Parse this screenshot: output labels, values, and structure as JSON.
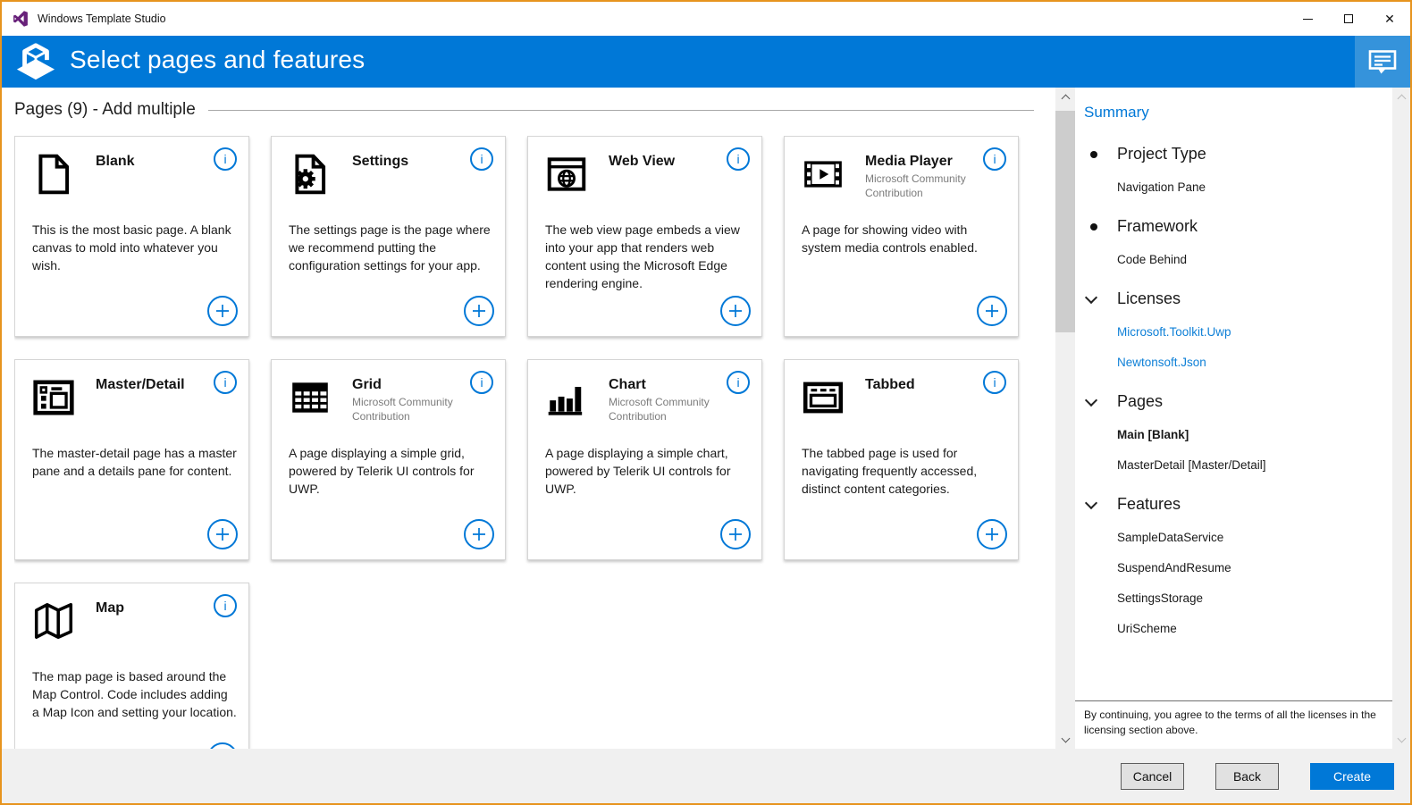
{
  "window": {
    "title": "Windows Template Studio",
    "app_icon": "visual-studio-icon",
    "controls": [
      {
        "icon": "minimize-icon"
      },
      {
        "icon": "maximize-icon"
      },
      {
        "icon": "close-icon"
      }
    ]
  },
  "header": {
    "title": "Select pages and features",
    "logo_icon": "wts-logo-icon",
    "feedback_icon": "feedback-icon"
  },
  "content": {
    "section_title": "Pages (9) - Add multiple",
    "card_info_icon": "info-icon",
    "card_add_icon": "add-icon",
    "cards": [
      {
        "title": "Blank",
        "subtitle": "",
        "icon": "blank-page-icon",
        "description": "This is the most basic page. A blank canvas to mold into whatever you wish."
      },
      {
        "title": "Settings",
        "subtitle": "",
        "icon": "settings-page-icon",
        "description": "The settings page is the page where we recommend putting the configuration settings for your app."
      },
      {
        "title": "Web View",
        "subtitle": "",
        "icon": "web-view-icon",
        "description": "The web view page embeds a view into your app that renders web content using the Microsoft Edge rendering engine."
      },
      {
        "title": "Media Player",
        "subtitle": "Microsoft Community Contribution",
        "icon": "media-player-icon",
        "description": "A page for showing video with system media controls enabled."
      },
      {
        "title": "Master/Detail",
        "subtitle": "",
        "icon": "master-detail-icon",
        "description": "The master-detail page has a master pane and a details pane for content."
      },
      {
        "title": "Grid",
        "subtitle": "Microsoft Community Contribution",
        "icon": "grid-icon",
        "description": "A page displaying a simple grid, powered by Telerik UI controls for UWP."
      },
      {
        "title": "Chart",
        "subtitle": "Microsoft Community Contribution",
        "icon": "chart-icon",
        "description": "A page displaying a simple chart, powered by Telerik UI controls for UWP."
      },
      {
        "title": "Tabbed",
        "subtitle": "",
        "icon": "tabbed-icon",
        "description": "The tabbed page is used for navigating frequently accessed, distinct content categories."
      },
      {
        "title": "Map",
        "subtitle": "",
        "icon": "map-icon",
        "description": "The map page is based around the Map Control. Code includes adding a Map Icon and setting your location."
      }
    ]
  },
  "sidebar": {
    "title": "Summary",
    "sections": [
      {
        "label": "Project Type",
        "marker": "bullet-icon",
        "items": [
          {
            "label": "Navigation Pane",
            "style": "plain"
          }
        ]
      },
      {
        "label": "Framework",
        "marker": "bullet-icon",
        "items": [
          {
            "label": "Code Behind",
            "style": "plain"
          }
        ]
      },
      {
        "label": "Licenses",
        "marker": "chevron-down-icon",
        "items": [
          {
            "label": "Microsoft.Toolkit.Uwp",
            "style": "link"
          },
          {
            "label": "Newtonsoft.Json",
            "style": "link"
          }
        ]
      },
      {
        "label": "Pages",
        "marker": "chevron-down-icon",
        "items": [
          {
            "label": "Main [Blank]",
            "style": "bold"
          },
          {
            "label": "MasterDetail [Master/Detail]",
            "style": "plain"
          }
        ]
      },
      {
        "label": "Features",
        "marker": "chevron-down-icon",
        "items": [
          {
            "label": "SampleDataService",
            "style": "plain"
          },
          {
            "label": "SuspendAndResume",
            "style": "plain"
          },
          {
            "label": "SettingsStorage",
            "style": "plain"
          },
          {
            "label": "UriScheme",
            "style": "plain"
          }
        ]
      }
    ],
    "license_note": "By continuing, you agree to the terms of all the licenses in the licensing section above.",
    "scroll_icons": {
      "up": "scroll-up-icon",
      "down": "scroll-down-icon"
    }
  },
  "content_scrollbar": {
    "up": "scroll-up-icon",
    "down": "scroll-down-icon",
    "has_thumb": true
  },
  "footer": {
    "buttons": [
      {
        "label": "Cancel",
        "style": "default"
      },
      {
        "label": "Back",
        "style": "default"
      },
      {
        "label": "Create",
        "style": "primary"
      }
    ]
  },
  "colors": {
    "accent_blue": "#0078d7",
    "header_blue": "#0078d7",
    "feedback_panel_blue": "#3593DB",
    "window_border_orange": "#E7941E",
    "link_blue": "#0F80D7",
    "card_border": "#D5D5D5",
    "footer_bg": "#F0F0F0",
    "button_bg": "#E1E1E1",
    "create_button_bg": "#0078D7",
    "scrollbar_thumb": "#CDCDCD",
    "vs_logo_purple": "#68217A"
  }
}
